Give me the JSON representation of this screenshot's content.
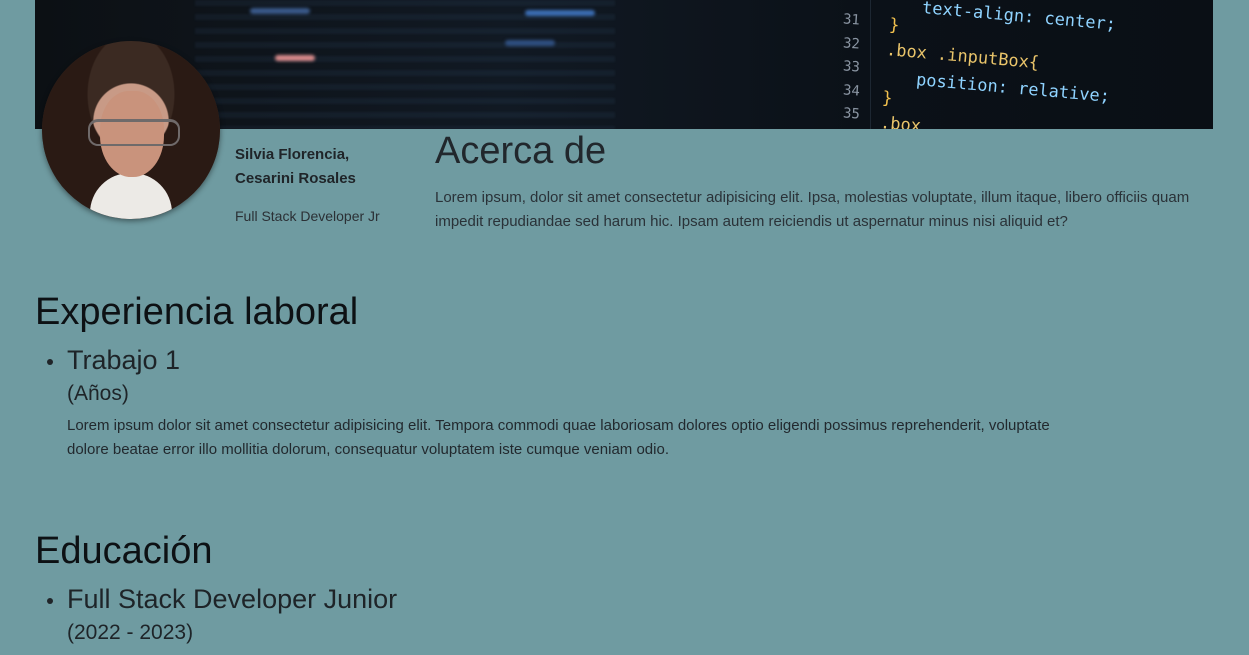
{
  "banner": {
    "line_numbers": [
      "31",
      "32",
      "33",
      "34",
      "35"
    ],
    "code_lines": [
      {
        "text": "text-align: center;",
        "kind": "prop-val"
      },
      {
        "text": "}",
        "kind": "brace"
      },
      {
        "text": ".box .inputBox{",
        "kind": "selector"
      },
      {
        "text": "position: relative;",
        "kind": "prop-val"
      },
      {
        "text": "}",
        "kind": "brace"
      },
      {
        "text": ".box",
        "kind": "selector"
      }
    ]
  },
  "profile": {
    "name_line1": "Silvia Florencia,",
    "name_line2": "Cesarini Rosales",
    "role": "Full Stack Developer Jr"
  },
  "about": {
    "title": "Acerca de",
    "text": "Lorem ipsum, dolor sit amet consectetur adipisicing elit. Ipsa, molestias voluptate, illum itaque, libero officiis quam impedit repudiandae sed harum hic. Ipsam autem reiciendis ut aspernatur minus nisi aliquid et?"
  },
  "experience": {
    "title": "Experiencia laboral",
    "items": [
      {
        "title": "Trabajo 1",
        "years": "(Años)",
        "description": "Lorem ipsum dolor sit amet consectetur adipisicing elit. Tempora commodi quae laboriosam dolores optio eligendi possimus reprehenderit, voluptate dolore beatae error illo mollitia dolorum, consequatur voluptatem iste cumque veniam odio."
      }
    ]
  },
  "education": {
    "title": "Educación",
    "items": [
      {
        "title": "Full Stack Developer Junior",
        "years": "(2022 - 2023)"
      }
    ]
  },
  "colors": {
    "background": "#6f9ba1",
    "text": "#1f2428"
  }
}
